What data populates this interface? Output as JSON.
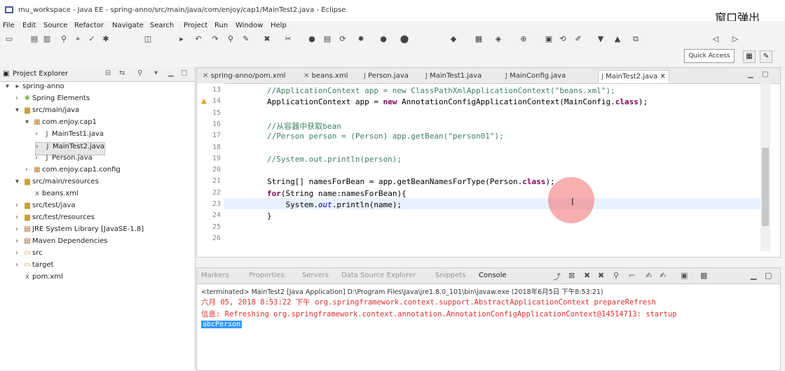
{
  "window": {
    "title": "mu_workspace - Java EE - spring-anno/src/main/java/com/enjoy/cap1/MainTest2.java - Eclipse",
    "overlay": "窗口弹出"
  },
  "menu": [
    "File",
    "Edit",
    "Source",
    "Refactor",
    "Navigate",
    "Search",
    "Project",
    "Run",
    "Window",
    "Help"
  ],
  "quick_access": "Quick Access",
  "project_explorer": {
    "title": "Project Explorer",
    "items": [
      {
        "label": "spring-anno",
        "icon": "project-icon",
        "depth": 0,
        "arrow": "▾"
      },
      {
        "label": "Spring Elements",
        "icon": "spring-icon",
        "depth": 1,
        "arrow": "›"
      },
      {
        "label": "src/main/java",
        "icon": "source-folder-icon",
        "depth": 1,
        "arrow": "▾"
      },
      {
        "label": "com.enjoy.cap1",
        "icon": "package-icon",
        "depth": 2,
        "arrow": "▾"
      },
      {
        "label": "MainTest1.java",
        "icon": "java-file-icon",
        "depth": 3,
        "arrow": "›"
      },
      {
        "label": "MainTest2.java",
        "icon": "java-file-icon",
        "depth": 3,
        "arrow": "›",
        "selected": true
      },
      {
        "label": "Person.java",
        "icon": "java-file-icon",
        "depth": 3,
        "arrow": "›"
      },
      {
        "label": "com.enjoy.cap1.config",
        "icon": "package-icon",
        "depth": 2,
        "arrow": "›"
      },
      {
        "label": "src/main/resources",
        "icon": "source-folder-icon",
        "depth": 1,
        "arrow": "▾"
      },
      {
        "label": "beans.xml",
        "icon": "xml-file-icon",
        "depth": 2,
        "arrow": ""
      },
      {
        "label": "src/test/java",
        "icon": "source-folder-icon",
        "depth": 1,
        "arrow": "›"
      },
      {
        "label": "src/test/resources",
        "icon": "source-folder-icon",
        "depth": 1,
        "arrow": "›"
      },
      {
        "label": "JRE System Library [JavaSE-1.8]",
        "icon": "library-icon",
        "depth": 1,
        "arrow": "›"
      },
      {
        "label": "Maven Dependencies",
        "icon": "library-icon",
        "depth": 1,
        "arrow": "›"
      },
      {
        "label": "src",
        "icon": "folder-icon",
        "depth": 1,
        "arrow": "›"
      },
      {
        "label": "target",
        "icon": "folder-icon",
        "depth": 1,
        "arrow": "›"
      },
      {
        "label": "pom.xml",
        "icon": "xml-file-icon",
        "depth": 1,
        "arrow": ""
      }
    ]
  },
  "editor": {
    "tabs": [
      "spring-anno/pom.xml",
      "beans.xml",
      "Person.java",
      "MainTest1.java",
      "MainConfig.java",
      "MainTest2.java"
    ],
    "active_tab": "MainTest2.java",
    "lines": [
      {
        "n": "13",
        "html": "<span class='cmt'>//ApplicationContext app = new ClassPathXmlApplicationContext(\"beans.xml\");</span>"
      },
      {
        "n": "14",
        "html": "ApplicationContext app = <span class='kw'>new</span> AnnotationConfigApplicationContext(MainConfig.<span class='kw'>class</span>);"
      },
      {
        "n": "15",
        "html": ""
      },
      {
        "n": "16",
        "html": "<span class='cmt'>//从容器中获取bean</span>"
      },
      {
        "n": "17",
        "html": "<span class='cmt'>//Person person = (Person) app.getBean(\"person01\");</span>"
      },
      {
        "n": "18",
        "html": ""
      },
      {
        "n": "19",
        "html": "<span class='cmt'>//System.out.println(person);</span>"
      },
      {
        "n": "20",
        "html": ""
      },
      {
        "n": "21",
        "html": "String[] namesForBean = app.getBeanNamesForType(Person.<span class='kw'>class</span>);"
      },
      {
        "n": "22",
        "html": "<span class='kw'>for</span>(String name:namesForBean){"
      },
      {
        "n": "23",
        "html": "    System.<span class='fld'>out</span>.println(name);"
      },
      {
        "n": "24",
        "html": "}"
      },
      {
        "n": "25",
        "html": ""
      },
      {
        "n": "26",
        "html": ""
      }
    ]
  },
  "console": {
    "tabs": [
      "Markers",
      "Properties",
      "Servers",
      "Data Source Explorer",
      "Snippets",
      "Console"
    ],
    "active_tab": "Console",
    "description": "<terminated> MainTest2 [Java Application] D:\\Program Files\\Java\\jre1.8.0_101\\bin\\javaw.exe (2018年6月5日 下午8:53:21)",
    "lines": [
      "六月 05, 2018 8:53:22 下午 org.springframework.context.support.AbstractApplicationContext prepareRefresh",
      "信息: Refreshing org.springframework.context.annotation.AnnotationConfigApplicationContext@14514713: startup"
    ],
    "output": "abcPerson"
  }
}
